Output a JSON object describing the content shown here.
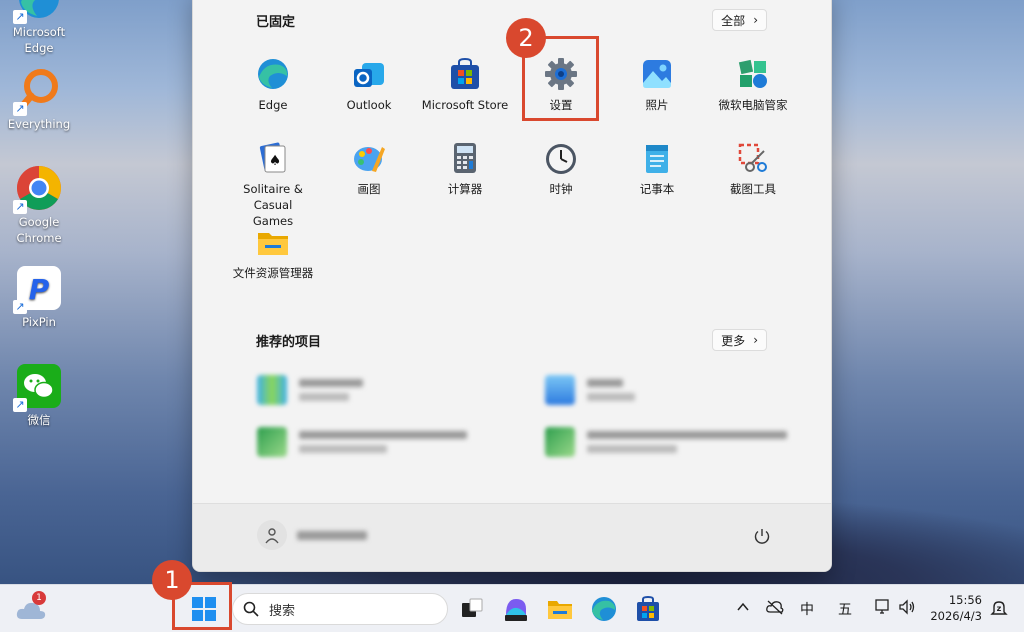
{
  "desktop": {
    "icons": [
      {
        "label": "Microsoft Edge",
        "icon": "edge-icon"
      },
      {
        "label": "Everything",
        "icon": "everything-icon"
      },
      {
        "label": "Google Chrome",
        "icon": "chrome-icon"
      },
      {
        "label": "PixPin",
        "icon": "pixpin-icon"
      },
      {
        "label": "微信",
        "icon": "wechat-icon"
      }
    ]
  },
  "start_menu": {
    "pinned_title": "已固定",
    "all_button": "全部",
    "pinned_apps": [
      {
        "label": "Edge",
        "icon": "edge-icon"
      },
      {
        "label": "Outlook",
        "icon": "outlook-icon"
      },
      {
        "label": "Microsoft Store",
        "icon": "store-icon"
      },
      {
        "label": "设置",
        "icon": "settings-gear-icon"
      },
      {
        "label": "照片",
        "icon": "photos-icon"
      },
      {
        "label": "微软电脑管家",
        "icon": "pc-manager-icon"
      },
      {
        "label": "Solitaire & Casual Games",
        "icon": "solitaire-icon"
      },
      {
        "label": "画图",
        "icon": "paint-icon"
      },
      {
        "label": "计算器",
        "icon": "calculator-icon"
      },
      {
        "label": "时钟",
        "icon": "clock-icon"
      },
      {
        "label": "记事本",
        "icon": "notepad-icon"
      },
      {
        "label": "截图工具",
        "icon": "snipping-tool-icon"
      },
      {
        "label": "文件资源管理器",
        "icon": "file-explorer-icon"
      }
    ],
    "recommended_title": "推荐的项目",
    "more_button": "更多"
  },
  "annotations": {
    "step1": "1",
    "step2": "2",
    "color": "#d9482e"
  },
  "taskbar": {
    "weather_badge": "1",
    "search_placeholder": "搜索",
    "tray_ime_lang": "中",
    "tray_weekday": "五",
    "time": "15:56",
    "date": "2026/4/3"
  }
}
